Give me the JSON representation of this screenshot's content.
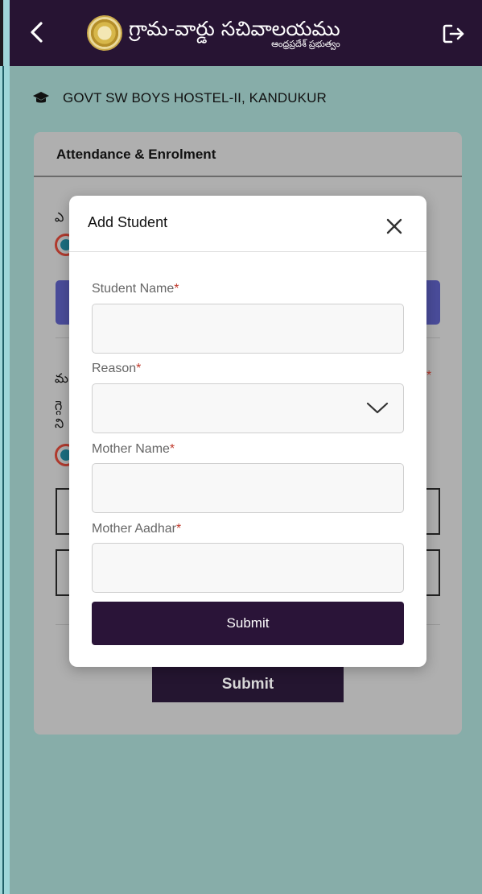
{
  "app_bar": {
    "title_telugu": "గ్రామ-వార్డు సచివాలయము",
    "subtitle_telugu": "ఆంధ్రప్రదేశ్ ప్రభుత్వం",
    "back_icon": "chevron-left-icon",
    "logout_icon": "logout-icon",
    "background_color": "#271433"
  },
  "office": {
    "icon": "graduation-cap-icon",
    "name": "GOVT SW BOYS HOSTEL-II, KANDUKUR"
  },
  "card": {
    "title": "Attendance & Enrolment",
    "partial_text_1": "ఎ",
    "partial_text_2": "మ",
    "partial_text_3": "గ్గె",
    "partial_text_4": "ని",
    "required_mark": "*",
    "submit_label": "Submit"
  },
  "modal": {
    "title": "Add Student",
    "close_icon": "close-icon",
    "fields": [
      {
        "label": "Student Name",
        "required": "*",
        "value": "",
        "type": "text"
      },
      {
        "label": "Reason",
        "required": "*",
        "value": "",
        "type": "select"
      },
      {
        "label": "Mother Name",
        "required": "*",
        "value": "",
        "type": "text"
      },
      {
        "label": "Mother Aadhar",
        "required": "*",
        "value": "",
        "type": "text"
      }
    ],
    "submit_label": "Submit",
    "submit_color": "#2a1438"
  },
  "colors": {
    "page_background": "#87ADA9",
    "required": "#c0392b"
  }
}
